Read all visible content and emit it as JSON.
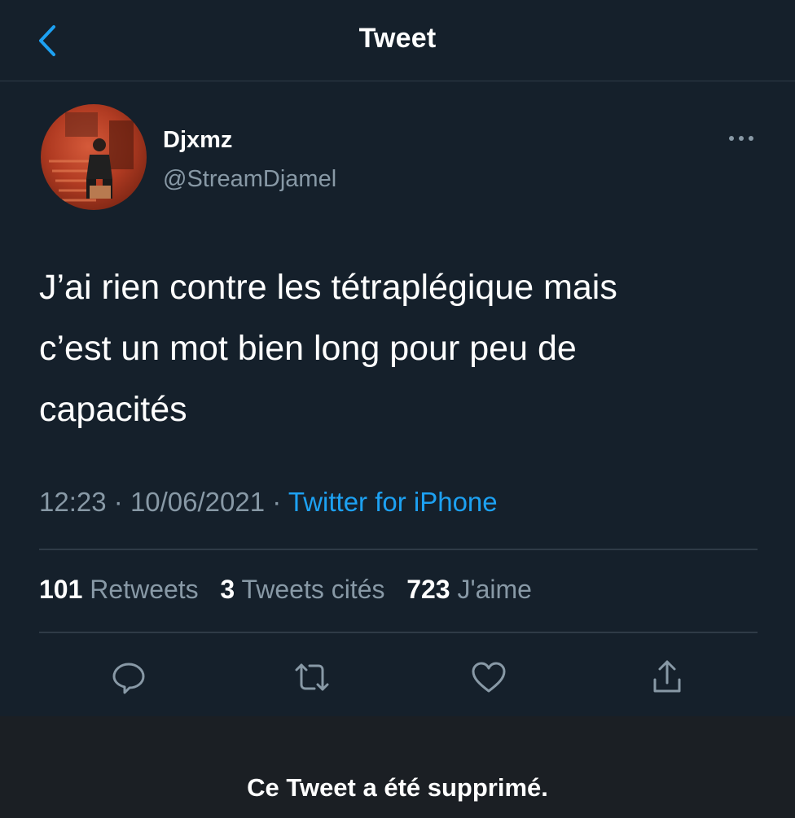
{
  "header": {
    "title": "Tweet",
    "back_icon": "chevron-left-icon"
  },
  "tweet": {
    "display_name": "Djxmz",
    "handle": "@StreamDjamel",
    "text": "J’ai rien contre les tétraplégique mais\nc’est un mot bien long pour peu de\ncapacités",
    "time": "12:23",
    "date": "10/06/2021",
    "separator": "·",
    "source": "Twitter for iPhone",
    "stats": {
      "retweets_count": "101",
      "retweets_label": "Retweets",
      "quotes_count": "3",
      "quotes_label": "Tweets cités",
      "likes_count": "723",
      "likes_label": "J'aime"
    },
    "actions": [
      "reply-icon",
      "retweet-icon",
      "like-icon",
      "share-icon"
    ]
  },
  "footer": {
    "message": "Ce Tweet a été supprimé."
  },
  "colors": {
    "background": "#15202b",
    "accent": "#1da1f2",
    "secondary_text": "#8899a6",
    "divider": "#2f3b47",
    "footer_bg": "#1b1f24"
  }
}
